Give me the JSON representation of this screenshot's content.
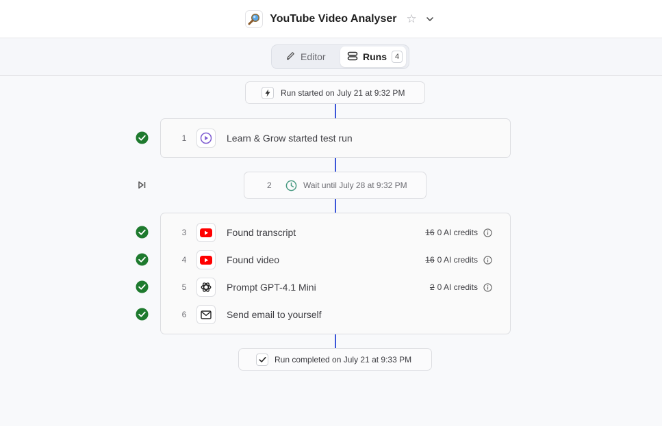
{
  "header": {
    "title": "YouTube Video Analyser",
    "logo_icon": "magnifier-icon",
    "star_glyph": "☆"
  },
  "toolbar": {
    "tabs": [
      {
        "label": "Editor",
        "icon": "pencil-icon",
        "active": false
      },
      {
        "label": "Runs",
        "icon": "runs-stack-icon",
        "active": true,
        "count": "4"
      }
    ]
  },
  "run": {
    "start_label": "Run started on July 21 at 9:32 PM",
    "end_label": "Run completed on July 21 at 9:33 PM",
    "steps": [
      {
        "num": "1",
        "label": "Learn & Grow started test run",
        "icon": "play-circle-icon",
        "status": "success"
      },
      {
        "num": "2",
        "label": "Wait until July 28 at 9:32 PM",
        "icon": "clock-icon",
        "status": "skipped"
      },
      {
        "num": "3",
        "label": "Found transcript",
        "icon": "youtube-icon",
        "status": "success",
        "credits_old": "16",
        "credits_new": "0 AI credits"
      },
      {
        "num": "4",
        "label": "Found video",
        "icon": "youtube-icon",
        "status": "success",
        "credits_old": "16",
        "credits_new": "0 AI credits"
      },
      {
        "num": "5",
        "label": "Prompt GPT-4.1 Mini",
        "icon": "openai-icon",
        "status": "success",
        "credits_old": "2",
        "credits_new": "0 AI credits"
      },
      {
        "num": "6",
        "label": "Send email to yourself",
        "icon": "mail-icon",
        "status": "success"
      }
    ]
  },
  "colors": {
    "connector": "#3a55d9",
    "success": "#1e7a2e",
    "youtube": "#ff0000",
    "clock": "#4a9b83",
    "play": "#7d5bd1"
  }
}
